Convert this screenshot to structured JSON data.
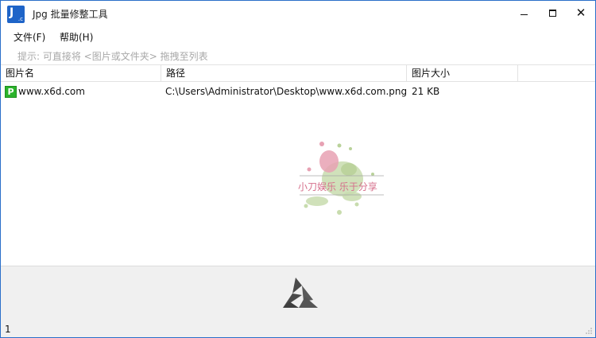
{
  "window": {
    "title": "Jpg 批量修整工具",
    "icon_letter": "J",
    "icon_sub": ".c"
  },
  "menu": {
    "file": "文件(F)",
    "help": "帮助(H)"
  },
  "hint": "提示: 可直接将 <图片或文件夹> 拖拽至列表",
  "table": {
    "columns": [
      "图片名",
      "路径",
      "图片大小"
    ],
    "rows": [
      {
        "icon": "P",
        "name": "www.x6d.com",
        "path": "C:\\Users\\Administrator\\Desktop\\www.x6d.com.png",
        "size": "21 KB"
      }
    ]
  },
  "watermark": {
    "text": "小刀娱乐 乐于分享"
  },
  "status": {
    "count": "1"
  },
  "colors": {
    "accent": "#1e64c8",
    "file_icon": "#2bb32b",
    "panel": "#f0f0f0"
  }
}
